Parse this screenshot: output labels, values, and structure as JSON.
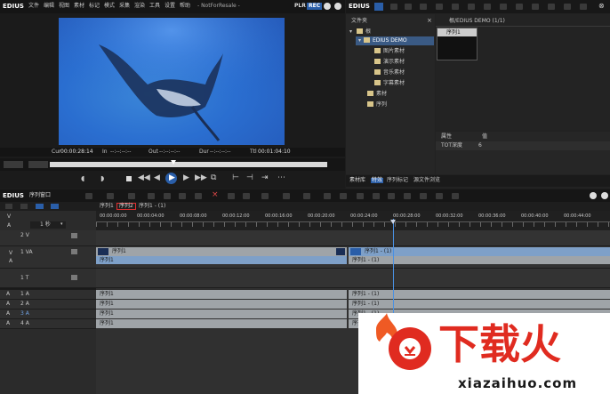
{
  "app": {
    "brand": "EDIUS",
    "menu": [
      "文件",
      "编辑",
      "视图",
      "素材",
      "标记",
      "模式",
      "采集",
      "渲染",
      "工具",
      "设置",
      "帮助"
    ],
    "project_title": "- NotForResale -",
    "plr_label": "PLR",
    "rec_label": "REC"
  },
  "player": {
    "cur_label": "Cur",
    "cur_value": "00:00:28:14",
    "in_label": "In",
    "in_value": "--:--:--:--",
    "out_label": "Out",
    "out_value": "--:--:--:--",
    "dur_label": "Dur",
    "dur_value": "--:--:--:--",
    "ttl_label": "Ttl",
    "ttl_value": "00:01:04:10"
  },
  "bin": {
    "brand": "EDIUS",
    "folder_header": "文件夹",
    "path": "根/EDIUS DEMO (1/1)",
    "folders": [
      "根",
      "EDIUS DEMO",
      "图片素材",
      "演示素材",
      "音乐素材",
      "字幕素材",
      "素材",
      "序列"
    ],
    "clip_name": "序列1",
    "prop_header_key": "属性",
    "prop_header_val": "值",
    "prop_key": "TOT深度",
    "prop_val": "6",
    "tabs": [
      "素材库",
      "特效",
      "序列标记",
      "源文件浏览"
    ]
  },
  "timeline": {
    "brand": "EDIUS",
    "title": "序列窗口",
    "seq_tab_1": "序列1",
    "seq_tab_2": "序列2",
    "seq_tab_3": "序列1 - (1)",
    "zoom": "1 秒",
    "ruler_ticks": [
      "00:00:00:00",
      "00:00:04:00",
      "00:00:08:00",
      "00:00:12:00",
      "00:00:16:00",
      "00:00:20:00",
      "00:00:24:00",
      "00:00:28:00",
      "00:00:32:00",
      "00:00:36:00",
      "00:00:40:00",
      "00:00:44:00"
    ],
    "tracks": [
      {
        "label": "2 V"
      },
      {
        "label": "1 VA"
      },
      {
        "label": "1 T"
      },
      {
        "label": "1 A"
      },
      {
        "label": "2 A"
      },
      {
        "label": "3 A"
      },
      {
        "label": "4 A"
      }
    ],
    "clip_seq": "序列1",
    "clip_seq_sub": "序列1 - (1)",
    "clip_seq_1": "序列1",
    "clip_seq_1b": "序列1 - (1)"
  },
  "watermark": {
    "logo_text": "下载火",
    "domain": "xiazaihuo.com",
    "colors": {
      "orange": "#ef5a24",
      "red": "#e02b20"
    }
  }
}
